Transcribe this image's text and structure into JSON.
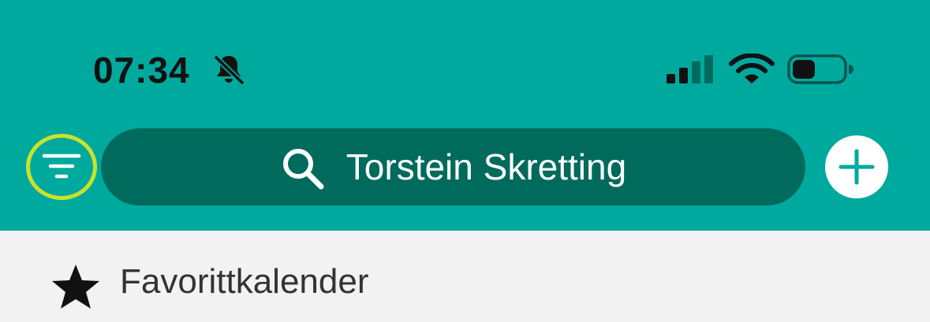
{
  "status_bar": {
    "time": "07:34",
    "icons": [
      "bell-slash-icon",
      "cellular-signal-icon",
      "wifi-icon",
      "battery-icon"
    ]
  },
  "header": {
    "filter_icon": "filter-icon",
    "search": {
      "text": "Torstein Skretting",
      "icon": "search-icon"
    },
    "add_icon": "plus-icon"
  },
  "list": {
    "favorites": {
      "label": "Favorittkalender",
      "icon": "star-icon"
    }
  },
  "colors": {
    "header_bg": "#00a99d",
    "search_bg": "#006a5c",
    "highlight_ring": "#c9e22a",
    "list_bg": "#f2f2f2"
  }
}
